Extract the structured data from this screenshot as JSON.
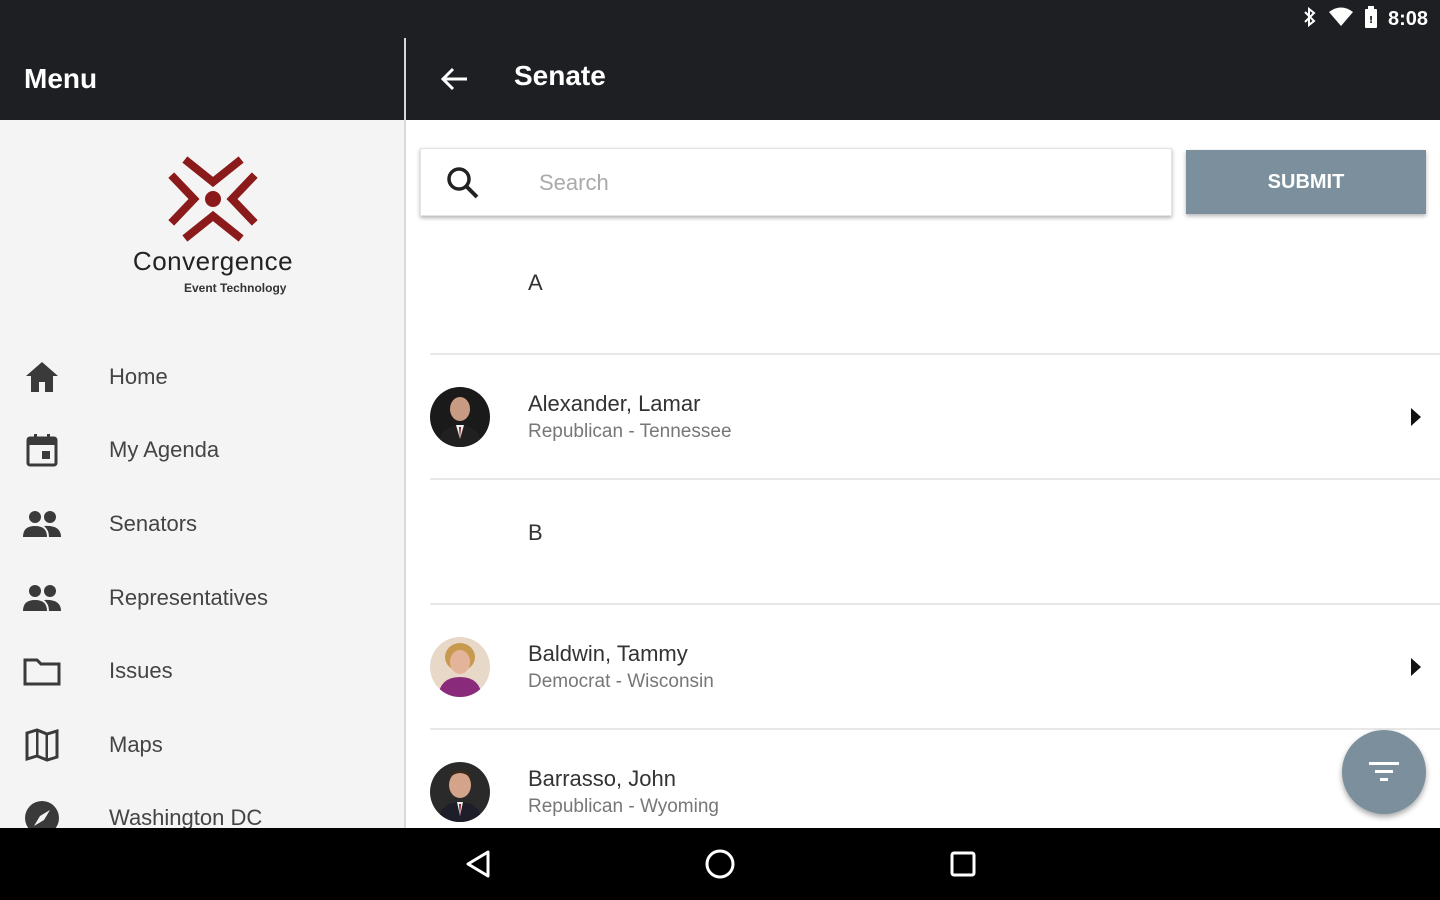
{
  "status_bar": {
    "time": "8:08"
  },
  "drawer": {
    "title": "Menu",
    "logo": {
      "name": "Convergence",
      "tagline": "Event Technology"
    },
    "items": [
      {
        "label": "Home",
        "icon": "home-icon"
      },
      {
        "label": "My Agenda",
        "icon": "calendar-icon"
      },
      {
        "label": "Senators",
        "icon": "people-icon"
      },
      {
        "label": "Representatives",
        "icon": "people-icon"
      },
      {
        "label": "Issues",
        "icon": "folder-icon"
      },
      {
        "label": "Maps",
        "icon": "map-icon"
      },
      {
        "label": "Washington DC",
        "icon": "compass-icon"
      }
    ]
  },
  "appbar": {
    "title": "Senate"
  },
  "search": {
    "placeholder": "Search",
    "value": "",
    "submit_label": "SUBMIT"
  },
  "sections": [
    {
      "letter": "A",
      "rows": [
        {
          "name": "Alexander, Lamar",
          "subtitle": "Republican - Tennessee"
        }
      ]
    },
    {
      "letter": "B",
      "rows": [
        {
          "name": "Baldwin, Tammy",
          "subtitle": "Democrat - Wisconsin"
        },
        {
          "name": "Barrasso, John",
          "subtitle": "Republican - Wyoming"
        }
      ]
    }
  ],
  "colors": {
    "accent": "#7b909c",
    "bar": "#1e1f22",
    "logo_red": "#8b1a1a"
  }
}
